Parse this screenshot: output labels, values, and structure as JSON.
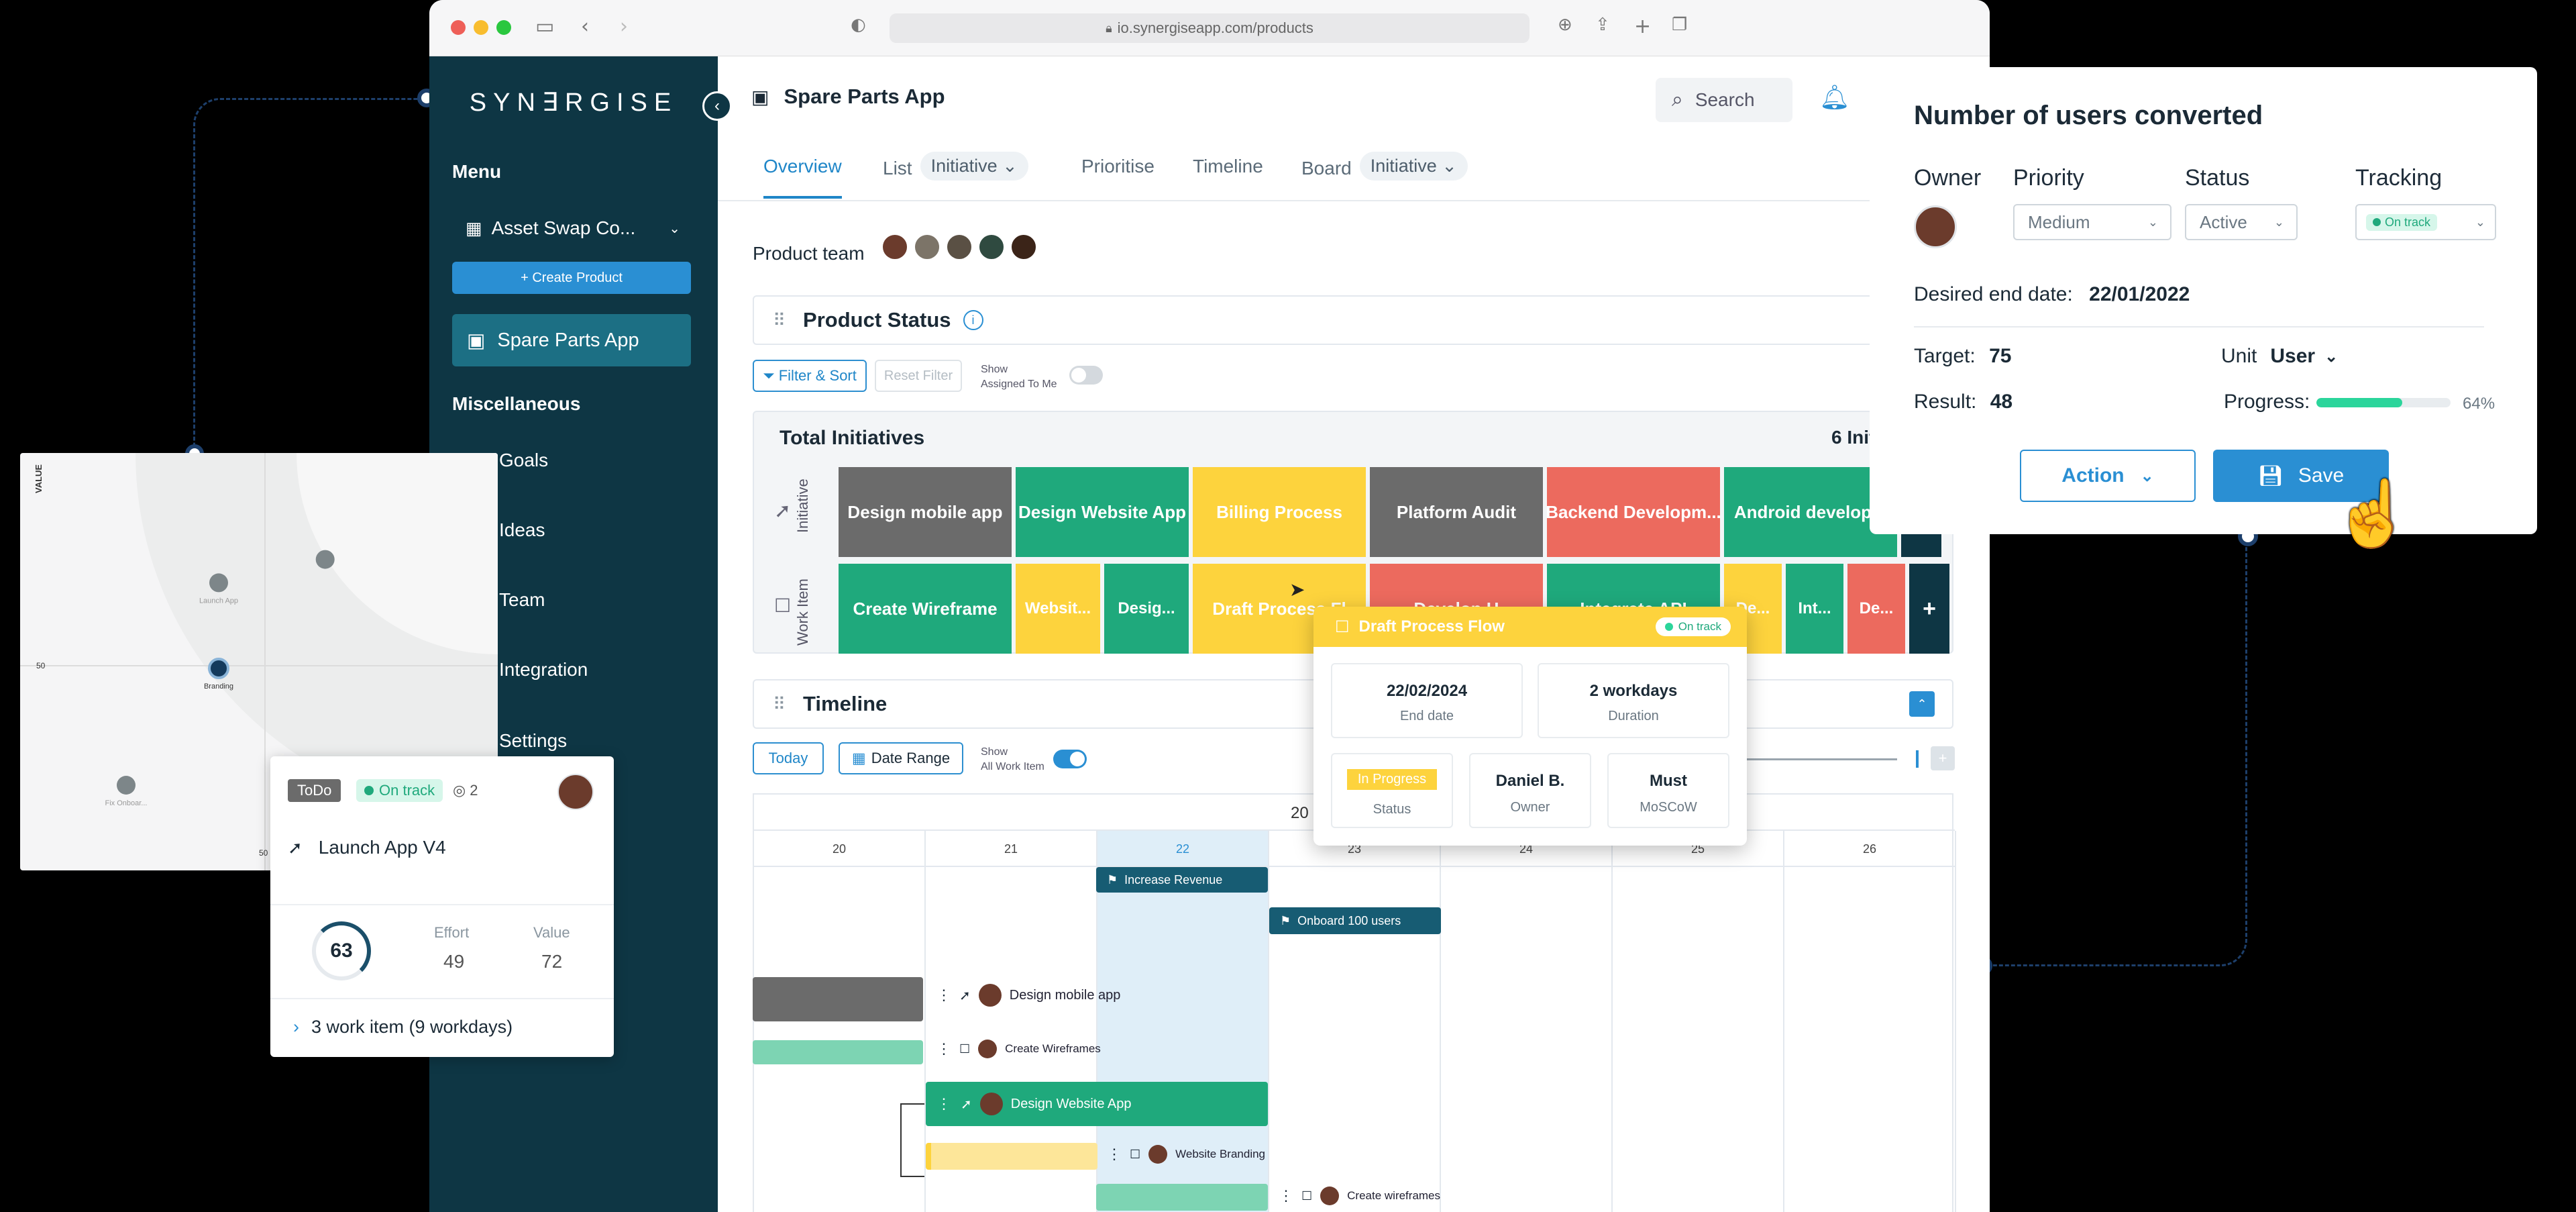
{
  "browser": {
    "url": "io.synergiseapp.com/products"
  },
  "sidebar": {
    "logo": "SYN∃RGISE",
    "menu_heading": "Menu",
    "workspace": "Asset Swap Co...",
    "create_product": "+ Create Product",
    "active_item": "Spare Parts App",
    "misc_heading": "Miscellaneous",
    "items": [
      "Goals",
      "Ideas",
      "Team",
      "Integration",
      "Settings"
    ]
  },
  "header": {
    "title": "Spare Parts App",
    "search": "Search"
  },
  "tabs": {
    "overview": "Overview",
    "list": "List",
    "list_pill": "Initiative",
    "prioritise": "Prioritise",
    "timeline": "Timeline",
    "board": "Board",
    "board_pill": "Initiative"
  },
  "product_team": {
    "label": "Product team"
  },
  "product_status": {
    "title": "Product Status",
    "filter_sort": "Filter & Sort",
    "reset_filter": "Reset Filter",
    "show_label": "Show",
    "assigned_label": "Assigned To Me",
    "total_initiatives": "Total Initiatives",
    "initiatives_count": "6 Initi",
    "row_initiative": "Initiative",
    "row_work_item": "Work Item",
    "initiatives": [
      {
        "label": "Design mobile app",
        "color": "#6b6b6b"
      },
      {
        "label": "Design Website App",
        "color": "#1fa97c"
      },
      {
        "label": "Billing Process",
        "color": "#fdd33d"
      },
      {
        "label": "Platform Audit",
        "color": "#6b6b6b"
      },
      {
        "label": "Backend Developm...",
        "color": "#ec6a5e"
      },
      {
        "label": "Android developm",
        "color": "#1fa97c"
      }
    ],
    "work_items": [
      {
        "label": "Create Wireframe",
        "color": "#1fa97c"
      },
      {
        "label": "Websit...",
        "color": "#fdd33d"
      },
      {
        "label": "Desig...",
        "color": "#1fa97c"
      },
      {
        "label": "Draft Process Fl",
        "color": "#fdd33d"
      },
      {
        "label": "Develop H",
        "color": "#ec6a5e"
      },
      {
        "label": "Integrate API",
        "color": "#1fa97c"
      },
      {
        "label": "De...",
        "color": "#fdd33d"
      },
      {
        "label": "Int...",
        "color": "#1fa97c"
      },
      {
        "label": "De...",
        "color": "#ec6a5e"
      }
    ],
    "add": "+"
  },
  "timeline": {
    "title": "Timeline",
    "today": "Today",
    "date_range": "Date Range",
    "show_label": "Show",
    "all_work_item": "All Work Item",
    "month_label": "20",
    "days": [
      "20",
      "21",
      "22",
      "23",
      "24",
      "25",
      "26"
    ],
    "bars": {
      "increase_revenue": "Increase Revenue",
      "onboard": "Onboard 100 users",
      "design_mobile": "Design mobile app",
      "create_wireframes": "Create Wireframes",
      "design_website": "Design Website App",
      "website_branding": "Website Branding",
      "create_wireframes2": "Create wireframes"
    }
  },
  "popover": {
    "title": "Draft Process Flow",
    "tracking": "On track",
    "end_date": "22/02/2024",
    "end_date_label": "End date",
    "duration": "2 workdays",
    "duration_label": "Duration",
    "status": "In Progress",
    "status_label": "Status",
    "owner": "Daniel B.",
    "owner_label": "Owner",
    "moscow": "Must",
    "moscow_label": "MoSCoW"
  },
  "panel": {
    "title": "Number of users converted",
    "owner_label": "Owner",
    "priority_label": "Priority",
    "priority_value": "Medium",
    "status_label": "Status",
    "status_value": "Active",
    "tracking_label": "Tracking",
    "tracking_value": "On track",
    "desired_end_label": "Desired end date:",
    "desired_end_value": "22/01/2022",
    "target_label": "Target:",
    "target_value": "75",
    "unit_label": "Unit",
    "unit_value": "User",
    "result_label": "Result:",
    "result_value": "48",
    "progress_label": "Progress:",
    "progress_value": "64%",
    "progress_fraction": 0.64,
    "action": "Action",
    "save": "Save"
  },
  "chart_data": {
    "type": "scatter",
    "ylabel": "VALUE",
    "y_tick_mid": "50",
    "x_tick_mid": "50",
    "points": [
      {
        "label": "Launch App",
        "x": 40,
        "y": 67
      },
      {
        "label": "",
        "x": 63,
        "y": 73
      },
      {
        "label": "Branding",
        "x": 40,
        "y": 45
      },
      {
        "label": "Fix Onboar...",
        "x": 20,
        "y": 15
      }
    ]
  },
  "card": {
    "status": "ToDo",
    "tracking": "On track",
    "comments": "2",
    "title": "Launch App V4",
    "score": "63",
    "effort_label": "Effort",
    "effort": "49",
    "value_label": "Value",
    "value": "72",
    "work_items": "3 work item (9 workdays)"
  },
  "colors": {
    "sidebar": "#0e3644",
    "accent_blue": "#2d8fd0",
    "green": "#1fa97c",
    "yellow": "#fdd33d",
    "red": "#ec6a5e",
    "gray": "#6b6b6b"
  }
}
